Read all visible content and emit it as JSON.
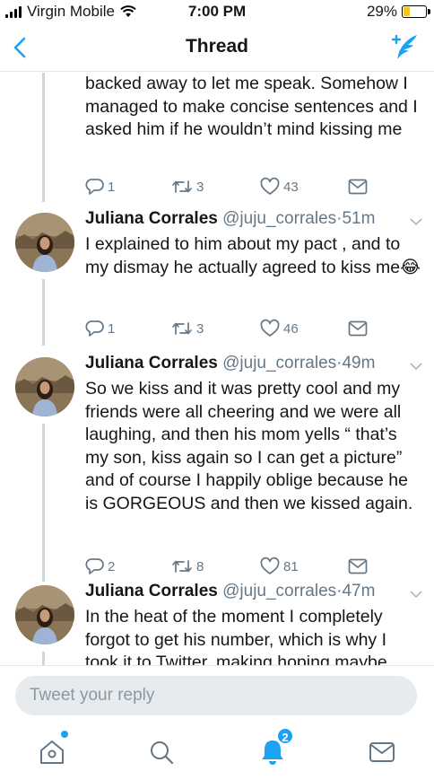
{
  "status_bar": {
    "carrier": "Virgin Mobile",
    "time": "7:00 PM",
    "battery": "29%",
    "battery_level": 0.29
  },
  "nav": {
    "title": "Thread",
    "back_icon": "chevron-left-icon",
    "compose_icon": "compose-tweet-icon"
  },
  "tweets": [
    {
      "text": "backed away to let me speak. Somehow I managed to make concise sentences and I asked him if he wouldn’t mind kissing me",
      "replies": "1",
      "retweets": "3",
      "likes": "43"
    },
    {
      "name": "Juliana Corrales",
      "handle": "@juju_corrales",
      "separator": "·",
      "time": "51m",
      "text": "I explained to him about my pact , and to my dismay he actually agreed to kiss me😂",
      "replies": "1",
      "retweets": "3",
      "likes": "46"
    },
    {
      "name": "Juliana Corrales",
      "handle": "@juju_corrales",
      "separator": "·",
      "time": "49m",
      "text": "So we kiss and it was pretty cool and my friends were all cheering and we were all laughing, and then his mom yells “ that’s my son, kiss again so I can get a picture” and of course I happily oblige because he is GORGEOUS and then we kissed again.",
      "replies": "2",
      "retweets": "8",
      "likes": "81"
    },
    {
      "name": "Juliana Corrales",
      "handle": "@juju_corrales",
      "separator": "·",
      "time": "47m",
      "text": "In the heat of the moment I completely forgot to get his number, which is why I took it to Twitter, making hoping maybe"
    }
  ],
  "reply": {
    "placeholder": "Tweet your reply"
  },
  "tab_bar": {
    "notifications_badge": "2",
    "accent": "#1da1f2"
  }
}
